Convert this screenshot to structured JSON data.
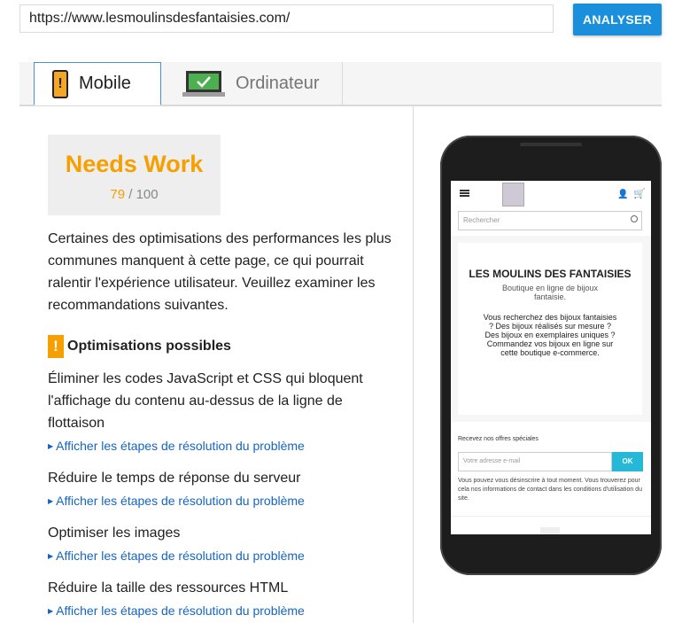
{
  "url_bar": {
    "value": "https://www.lesmoulinsdesfantaisies.com/",
    "button_label": "ANALYSER"
  },
  "tabs": [
    {
      "label": "Mobile",
      "icon": "smartphone-warning-icon",
      "active": true
    },
    {
      "label": "Ordinateur",
      "icon": "desktop-check-icon",
      "active": false
    }
  ],
  "score": {
    "title": "Needs Work",
    "value": "79",
    "separator": " / ",
    "max": "100",
    "color": "#f5a000"
  },
  "summary": "Certaines des optimisations des performances les plus communes manquent à cette page, ce qui pourrait ralentir l'expérience utilisateur. Veuillez examiner les recommandations suivantes.",
  "section": {
    "icon": "warning-icon",
    "warning_glyph": "!",
    "title": "Optimisations possibles"
  },
  "rules": [
    {
      "title": "Éliminer les codes JavaScript et CSS qui bloquent l'affichage du contenu au-dessus de la ligne de flottaison",
      "link": "Afficher les étapes de résolution du problème"
    },
    {
      "title": "Réduire le temps de réponse du serveur",
      "link": "Afficher les étapes de résolution du problème"
    },
    {
      "title": "Optimiser les images",
      "link": "Afficher les étapes de résolution du problème"
    },
    {
      "title": "Réduire la taille des ressources HTML",
      "link": "Afficher les étapes de résolution du problème"
    }
  ],
  "preview": {
    "search_placeholder": "Rechercher",
    "shop_title": "LES MOULINS DES FANTAISIES",
    "shop_subtitle": "Boutique en ligne de bijoux fantaisie.",
    "shop_text": "Vous recherchez des bijoux fantaisies ? Des bijoux réalisés sur mesure ? Des bijoux en exemplaires uniques ? Commandez vos bijoux en ligne sur cette boutique e-commerce.",
    "newsletter_label": "Recevez nos offres spéciales",
    "newsletter_placeholder": "Votre adresse e-mail",
    "newsletter_button": "OK",
    "disclaimer": "Vous pouvez vous désinscrire à tout moment. Vous trouverez pour cela nos informations de contact dans les conditions d'utilisation du site."
  },
  "colors": {
    "accent_blue": "#1a8fdc",
    "link_blue": "#1565c0",
    "warning_orange": "#f5a000"
  }
}
